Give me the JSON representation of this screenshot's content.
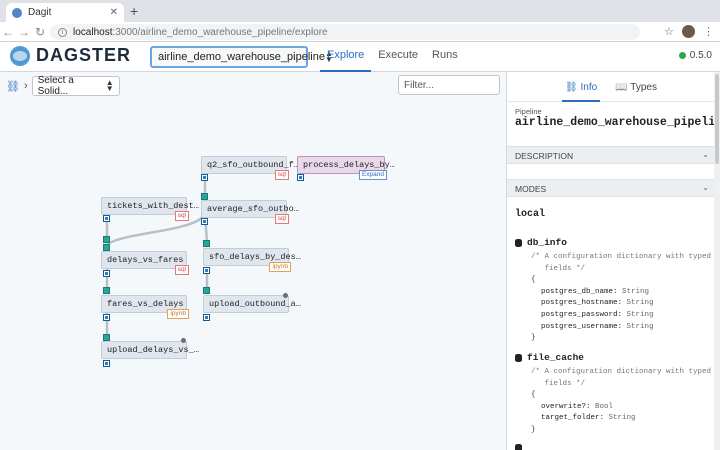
{
  "browser": {
    "tab_title": "Dagit",
    "url_host": "localhost",
    "url_path": ":3000/airline_demo_warehouse_pipeline/explore"
  },
  "header": {
    "logo_text": "DAGSTER",
    "pipeline_selected": "airline_demo_warehouse_pipeline",
    "tabs": [
      {
        "label": "Explore",
        "active": true
      },
      {
        "label": "Execute",
        "active": false
      },
      {
        "label": "Runs",
        "active": false
      }
    ],
    "version": "0.5.0",
    "status_color": "#2ea84a",
    "accent_color": "#2b6dbd"
  },
  "graph": {
    "solid_select": "Select a Solid...",
    "filter_placeholder": "Filter...",
    "nodes": [
      {
        "id": "q2",
        "label": "q2_sfo_outbound_f…",
        "tag": "sql"
      },
      {
        "id": "process",
        "label": "process_delays_by…",
        "tag": "Expand"
      },
      {
        "id": "tickets",
        "label": "tickets_with_dest…",
        "tag": "sql"
      },
      {
        "id": "average",
        "label": "average_sfo_outbo…",
        "tag": "sql"
      },
      {
        "id": "delays",
        "label": "delays_vs_fares",
        "tag": "sql"
      },
      {
        "id": "sfo",
        "label": "sfo_delays_by_des…",
        "tag": "ipynb"
      },
      {
        "id": "fares",
        "label": "fares_vs_delays",
        "tag": "ipynb"
      },
      {
        "id": "upload_out",
        "label": "upload_outbound_a…",
        "tag": ""
      },
      {
        "id": "upload_del",
        "label": "upload_delays_vs_…",
        "tag": ""
      }
    ]
  },
  "panel": {
    "tabs": [
      {
        "label": "Info",
        "icon": "tree-icon",
        "active": true
      },
      {
        "label": "Types",
        "icon": "book-icon",
        "active": false
      }
    ],
    "pipeline_label": "Pipeline",
    "pipeline_name": "airline_demo_warehouse_pipeline",
    "description_header": "DESCRIPTION",
    "modes_header": "MODES",
    "mode_name": "local",
    "resources": [
      {
        "name": "db_info",
        "comment_lines": [
          "/* A configuration dictionary with typed",
          "   fields */"
        ],
        "open": "{",
        "fields": [
          {
            "key": "postgres_db_name",
            "type": "String"
          },
          {
            "key": "postgres_hostname",
            "type": "String"
          },
          {
            "key": "postgres_password",
            "type": "String"
          },
          {
            "key": "postgres_username",
            "type": "String"
          }
        ],
        "close": "}"
      },
      {
        "name": "file_cache",
        "comment_lines": [
          "/* A configuration dictionary with typed",
          "   fields */"
        ],
        "open": "{",
        "fields": [
          {
            "key": "overwrite?",
            "type": "Bool"
          },
          {
            "key": "target_folder",
            "type": "String"
          }
        ],
        "close": "}"
      }
    ]
  }
}
